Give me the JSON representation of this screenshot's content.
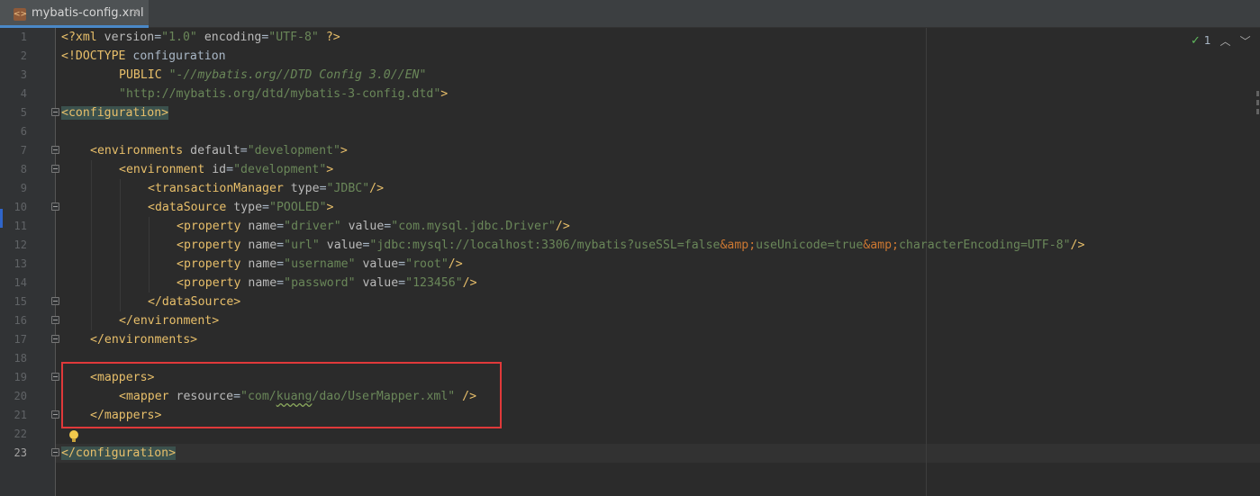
{
  "tab": {
    "filename": "mybatis-config.xml",
    "icon": "xml-file-icon",
    "close_glyph": "×"
  },
  "inspection": {
    "count": "1",
    "up": "^",
    "down": "v",
    "icon": "check-icon"
  },
  "line_numbers": [
    "1",
    "2",
    "3",
    "4",
    "5",
    "6",
    "7",
    "8",
    "9",
    "10",
    "11",
    "12",
    "13",
    "14",
    "15",
    "16",
    "17",
    "18",
    "19",
    "20",
    "21",
    "22",
    "23"
  ],
  "current_line": 23,
  "lines": {
    "l1": {
      "a1": "<?xml ",
      "a2": "version",
      "a3": "=",
      "a4": "\"1.0\"",
      "a5": " encoding",
      "a6": "=",
      "a7": "\"UTF-8\"",
      "a8": " ?>"
    },
    "l2": {
      "a1": "<!DOCTYPE ",
      "a2": "configuration"
    },
    "l3": {
      "a1": "PUBLIC ",
      "a2": "\"-//mybatis.org//DTD Config 3.0//EN\""
    },
    "l4": {
      "a1": "\"http://mybatis.org/dtd/mybatis-3-config.dtd\"",
      "a2": ">"
    },
    "l5": {
      "a1": "<configuration>"
    },
    "l7": {
      "a1": "<environments ",
      "a2": "default",
      "a3": "=",
      "a4": "\"development\"",
      "a5": ">"
    },
    "l8": {
      "a1": "<environment ",
      "a2": "id",
      "a3": "=",
      "a4": "\"development\"",
      "a5": ">"
    },
    "l9": {
      "a1": "<transactionManager ",
      "a2": "type",
      "a3": "=",
      "a4": "\"JDBC\"",
      "a5": "/>"
    },
    "l10": {
      "a1": "<dataSource ",
      "a2": "type",
      "a3": "=",
      "a4": "\"POOLED\"",
      "a5": ">"
    },
    "l11": {
      "a1": "<property ",
      "a2": "name",
      "a3": "=",
      "a4": "\"driver\"",
      "a5": " value",
      "a6": "=",
      "a7": "\"com.mysql.jdbc.Driver\"",
      "a8": "/>"
    },
    "l12": {
      "a1": "<property ",
      "a2": "name",
      "a3": "=",
      "a4": "\"url\"",
      "a5": " value",
      "a6": "=",
      "a7": "\"jdbc:mysql://localhost:3306/mybatis?useSSL=false",
      "a8": "&amp;",
      "a9": "useUnicode=true",
      "a10": "&amp;",
      "a11": "characterEncoding=UTF-8\"",
      "a12": "/>"
    },
    "l13": {
      "a1": "<property ",
      "a2": "name",
      "a3": "=",
      "a4": "\"username\"",
      "a5": " value",
      "a6": "=",
      "a7": "\"root\"",
      "a8": "/>"
    },
    "l14": {
      "a1": "<property ",
      "a2": "name",
      "a3": "=",
      "a4": "\"password\"",
      "a5": " value",
      "a6": "=",
      "a7": "\"123456\"",
      "a8": "/>"
    },
    "l15": {
      "a1": "</dataSource>"
    },
    "l16": {
      "a1": "</environment>"
    },
    "l17": {
      "a1": "</environments>"
    },
    "l19": {
      "a1": "<mappers>"
    },
    "l20": {
      "a1": "<mapper ",
      "a2": "resource",
      "a3": "=",
      "a4": "\"com/",
      "a5": "kuang",
      "a6": "/dao/UserMapper.xml\"",
      "a7": " />"
    },
    "l21": {
      "a1": "</mappers>"
    },
    "l23": {
      "a1": "</configuration>"
    }
  },
  "colors": {
    "tag": "#e8bf6a",
    "attribute": "#bababa",
    "value": "#6a8759",
    "entity": "#cc7832",
    "highlight_box": "#e0393a",
    "tab_underline": "#4a88c7"
  }
}
